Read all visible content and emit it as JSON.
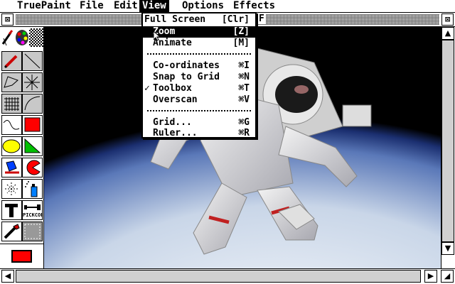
{
  "menubar": {
    "items": [
      "TruePaint",
      "File",
      "Edit",
      "View",
      "Options",
      "Effects"
    ],
    "active": "View"
  },
  "window": {
    "title_fragment": "F",
    "closebox_glyph": "⊠",
    "fullbox_glyph": "⊠"
  },
  "view_menu": {
    "items": [
      {
        "label": "Full Screen",
        "shortcut": "[Clr]",
        "checked": false,
        "highlighted": false
      },
      {
        "label": "Zoom",
        "shortcut": "[Z]",
        "checked": false,
        "highlighted": true
      },
      {
        "label": "Animate",
        "shortcut": "[M]",
        "checked": false,
        "highlighted": false
      },
      {
        "label": "Co-ordinates",
        "shortcut": "⌘I",
        "checked": false,
        "highlighted": false
      },
      {
        "label": "Snap to Grid",
        "shortcut": "⌘N",
        "checked": false,
        "highlighted": false
      },
      {
        "label": "Toolbox",
        "shortcut": "⌘T",
        "checked": true,
        "highlighted": false
      },
      {
        "label": "Overscan",
        "shortcut": "⌘V",
        "checked": false,
        "highlighted": false
      },
      {
        "label": "Grid...",
        "shortcut": "⌘G",
        "checked": false,
        "highlighted": false
      },
      {
        "label": "Ruler...",
        "shortcut": "⌘R",
        "checked": false,
        "highlighted": false
      }
    ],
    "checkmark": "✓"
  },
  "toolbox": {
    "pickcol_label": "PICKCOL",
    "current_color": "#ff0000",
    "tools": [
      "brush-icon",
      "palette-icon",
      "pattern-icon",
      "pencil-icon",
      "line-icon",
      "polygon-icon",
      "starburst-icon",
      "grid-fill-icon",
      "curve-icon",
      "freehand-icon",
      "rectangle-fill-icon",
      "ellipse-fill-icon",
      "triangle-fill-icon",
      "paint-bucket-icon",
      "pacman-arc-icon",
      "sparkle-icon",
      "spray-can-icon",
      "text-tool-icon",
      "pickcol-icon",
      "dropper-icon",
      "selection-icon"
    ]
  },
  "scrollbars": {
    "up_glyph": "▲",
    "down_glyph": "▼",
    "left_glyph": "◀",
    "right_glyph": "▶",
    "resize_glyph": "◢"
  },
  "colors": {
    "menu_active_bg": "#000000",
    "tool_bg": "#c8c8c8",
    "red": "#ff0000",
    "yellow": "#ffff00",
    "green": "#00c000"
  }
}
